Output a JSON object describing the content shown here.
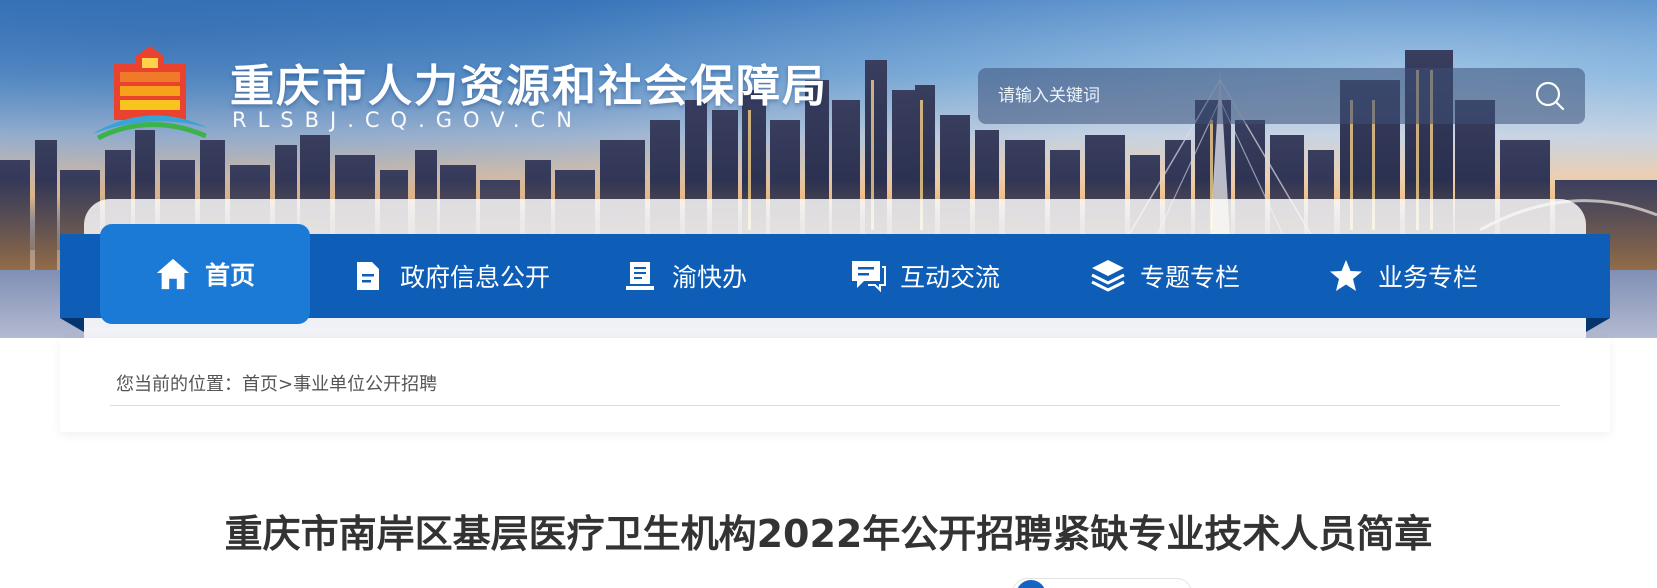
{
  "site": {
    "title": "重庆市人力资源和社会保障局",
    "url_text": "RLSBJ.CQ.GOV.CN",
    "logo_icon": "city-emblem-logo"
  },
  "search": {
    "placeholder": "请输入关键词",
    "value": "",
    "icon": "search-icon"
  },
  "nav": {
    "items": [
      {
        "label": "首页",
        "icon": "home-icon",
        "active": true
      },
      {
        "label": "政府信息公开",
        "icon": "document-icon",
        "active": false
      },
      {
        "label": "渝快办",
        "icon": "book-stand-icon",
        "active": false
      },
      {
        "label": "互动交流",
        "icon": "chat-icon",
        "active": false
      },
      {
        "label": "专题专栏",
        "icon": "layers-icon",
        "active": false
      },
      {
        "label": "业务专栏",
        "icon": "star-icon",
        "active": false
      }
    ]
  },
  "breadcrumb": {
    "prefix": "您当前的位置：",
    "items": [
      "首页",
      "事业单位公开招聘"
    ],
    "separator": ">"
  },
  "article": {
    "title": "重庆市南岸区基层医疗卫生机构2022年公开招聘紧缺专业技术人员简章"
  },
  "colors": {
    "nav_bg": "#0e5db7",
    "nav_active": "#1a7ad6",
    "text": "#333333"
  }
}
